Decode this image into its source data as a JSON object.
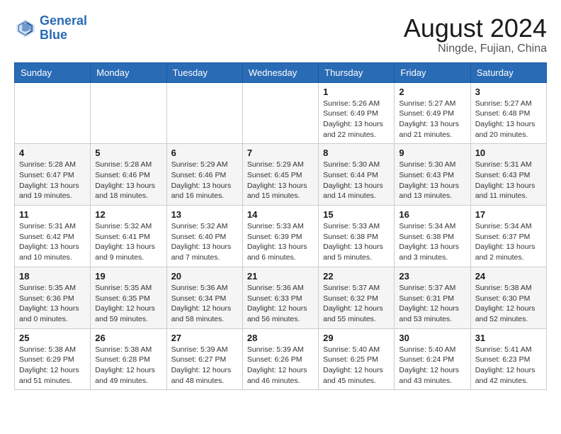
{
  "header": {
    "logo_line1": "General",
    "logo_line2": "Blue",
    "title": "August 2024",
    "subtitle": "Ningde, Fujian, China"
  },
  "weekdays": [
    "Sunday",
    "Monday",
    "Tuesday",
    "Wednesday",
    "Thursday",
    "Friday",
    "Saturday"
  ],
  "weeks": [
    [
      {
        "day": "",
        "info": ""
      },
      {
        "day": "",
        "info": ""
      },
      {
        "day": "",
        "info": ""
      },
      {
        "day": "",
        "info": ""
      },
      {
        "day": "1",
        "info": "Sunrise: 5:26 AM\nSunset: 6:49 PM\nDaylight: 13 hours\nand 22 minutes."
      },
      {
        "day": "2",
        "info": "Sunrise: 5:27 AM\nSunset: 6:49 PM\nDaylight: 13 hours\nand 21 minutes."
      },
      {
        "day": "3",
        "info": "Sunrise: 5:27 AM\nSunset: 6:48 PM\nDaylight: 13 hours\nand 20 minutes."
      }
    ],
    [
      {
        "day": "4",
        "info": "Sunrise: 5:28 AM\nSunset: 6:47 PM\nDaylight: 13 hours\nand 19 minutes."
      },
      {
        "day": "5",
        "info": "Sunrise: 5:28 AM\nSunset: 6:46 PM\nDaylight: 13 hours\nand 18 minutes."
      },
      {
        "day": "6",
        "info": "Sunrise: 5:29 AM\nSunset: 6:46 PM\nDaylight: 13 hours\nand 16 minutes."
      },
      {
        "day": "7",
        "info": "Sunrise: 5:29 AM\nSunset: 6:45 PM\nDaylight: 13 hours\nand 15 minutes."
      },
      {
        "day": "8",
        "info": "Sunrise: 5:30 AM\nSunset: 6:44 PM\nDaylight: 13 hours\nand 14 minutes."
      },
      {
        "day": "9",
        "info": "Sunrise: 5:30 AM\nSunset: 6:43 PM\nDaylight: 13 hours\nand 13 minutes."
      },
      {
        "day": "10",
        "info": "Sunrise: 5:31 AM\nSunset: 6:43 PM\nDaylight: 13 hours\nand 11 minutes."
      }
    ],
    [
      {
        "day": "11",
        "info": "Sunrise: 5:31 AM\nSunset: 6:42 PM\nDaylight: 13 hours\nand 10 minutes."
      },
      {
        "day": "12",
        "info": "Sunrise: 5:32 AM\nSunset: 6:41 PM\nDaylight: 13 hours\nand 9 minutes."
      },
      {
        "day": "13",
        "info": "Sunrise: 5:32 AM\nSunset: 6:40 PM\nDaylight: 13 hours\nand 7 minutes."
      },
      {
        "day": "14",
        "info": "Sunrise: 5:33 AM\nSunset: 6:39 PM\nDaylight: 13 hours\nand 6 minutes."
      },
      {
        "day": "15",
        "info": "Sunrise: 5:33 AM\nSunset: 6:38 PM\nDaylight: 13 hours\nand 5 minutes."
      },
      {
        "day": "16",
        "info": "Sunrise: 5:34 AM\nSunset: 6:38 PM\nDaylight: 13 hours\nand 3 minutes."
      },
      {
        "day": "17",
        "info": "Sunrise: 5:34 AM\nSunset: 6:37 PM\nDaylight: 13 hours\nand 2 minutes."
      }
    ],
    [
      {
        "day": "18",
        "info": "Sunrise: 5:35 AM\nSunset: 6:36 PM\nDaylight: 13 hours\nand 0 minutes."
      },
      {
        "day": "19",
        "info": "Sunrise: 5:35 AM\nSunset: 6:35 PM\nDaylight: 12 hours\nand 59 minutes."
      },
      {
        "day": "20",
        "info": "Sunrise: 5:36 AM\nSunset: 6:34 PM\nDaylight: 12 hours\nand 58 minutes."
      },
      {
        "day": "21",
        "info": "Sunrise: 5:36 AM\nSunset: 6:33 PM\nDaylight: 12 hours\nand 56 minutes."
      },
      {
        "day": "22",
        "info": "Sunrise: 5:37 AM\nSunset: 6:32 PM\nDaylight: 12 hours\nand 55 minutes."
      },
      {
        "day": "23",
        "info": "Sunrise: 5:37 AM\nSunset: 6:31 PM\nDaylight: 12 hours\nand 53 minutes."
      },
      {
        "day": "24",
        "info": "Sunrise: 5:38 AM\nSunset: 6:30 PM\nDaylight: 12 hours\nand 52 minutes."
      }
    ],
    [
      {
        "day": "25",
        "info": "Sunrise: 5:38 AM\nSunset: 6:29 PM\nDaylight: 12 hours\nand 51 minutes."
      },
      {
        "day": "26",
        "info": "Sunrise: 5:38 AM\nSunset: 6:28 PM\nDaylight: 12 hours\nand 49 minutes."
      },
      {
        "day": "27",
        "info": "Sunrise: 5:39 AM\nSunset: 6:27 PM\nDaylight: 12 hours\nand 48 minutes."
      },
      {
        "day": "28",
        "info": "Sunrise: 5:39 AM\nSunset: 6:26 PM\nDaylight: 12 hours\nand 46 minutes."
      },
      {
        "day": "29",
        "info": "Sunrise: 5:40 AM\nSunset: 6:25 PM\nDaylight: 12 hours\nand 45 minutes."
      },
      {
        "day": "30",
        "info": "Sunrise: 5:40 AM\nSunset: 6:24 PM\nDaylight: 12 hours\nand 43 minutes."
      },
      {
        "day": "31",
        "info": "Sunrise: 5:41 AM\nSunset: 6:23 PM\nDaylight: 12 hours\nand 42 minutes."
      }
    ]
  ]
}
